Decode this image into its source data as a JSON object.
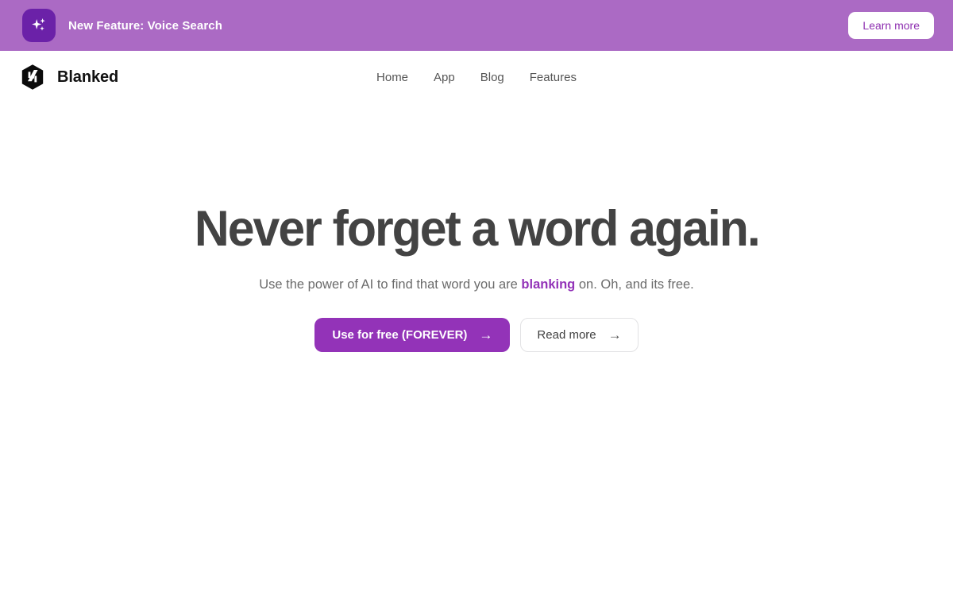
{
  "banner": {
    "badge_icon": "sparkles-icon",
    "message": "New Feature: Voice Search",
    "cta_label": "Learn more",
    "background_color": "#ab6ac4",
    "badge_color": "#6b21a8",
    "cta_text_color": "#8e2fb0"
  },
  "header": {
    "logo_icon": "blanked-hexagon-logo-icon",
    "brand_name": "Blanked",
    "nav": [
      {
        "label": "Home"
      },
      {
        "label": "App"
      },
      {
        "label": "Blog"
      },
      {
        "label": "Features"
      }
    ]
  },
  "hero": {
    "title": "Never forget a word again.",
    "subtitle_before": "Use the power of AI to find that word you are ",
    "subtitle_highlight": "blanking",
    "subtitle_after": " on. Oh, and its free.",
    "primary_cta": {
      "label": "Use for free (FOREVER)",
      "arrow": "→"
    },
    "secondary_cta": {
      "label": "Read more",
      "arrow": "→"
    },
    "title_color": "#434343",
    "accent_color": "#9333b8"
  }
}
